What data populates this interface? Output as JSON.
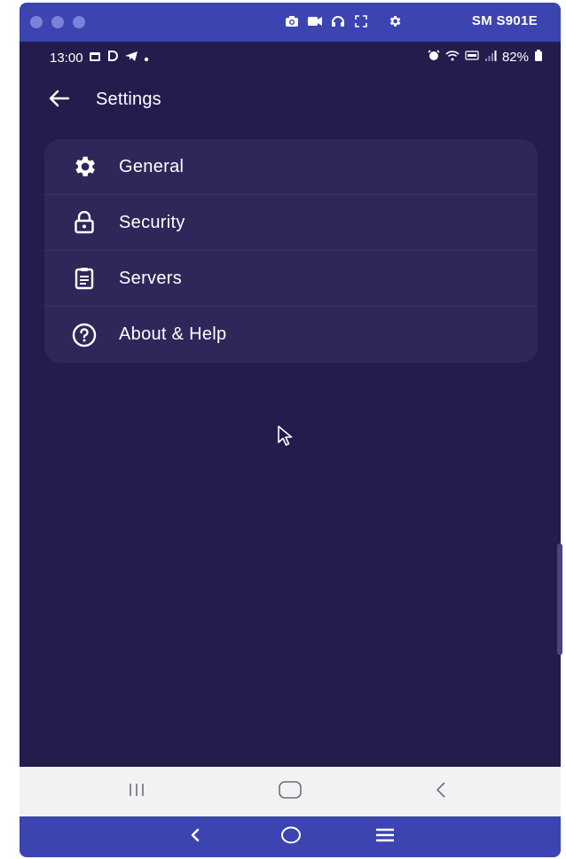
{
  "emulator": {
    "device_name": "SM S901E",
    "toolbar_icons": [
      "camera-icon",
      "video-icon",
      "headphones-icon",
      "fullscreen-icon",
      "gear-icon"
    ]
  },
  "status_bar": {
    "time": "13:00",
    "battery": "82%"
  },
  "app_bar": {
    "title": "Settings"
  },
  "menu": {
    "items": [
      {
        "label": "General",
        "icon": "gear-icon"
      },
      {
        "label": "Security",
        "icon": "lock-icon"
      },
      {
        "label": "Servers",
        "icon": "clipboard-icon"
      },
      {
        "label": "About & Help",
        "icon": "help-circle-icon"
      }
    ]
  },
  "colors": {
    "screen_bg": "#241c4d",
    "card_bg": "#2f2759",
    "emulator_bar": "#3b44b0",
    "nav_bar": "#f2f2f4"
  }
}
